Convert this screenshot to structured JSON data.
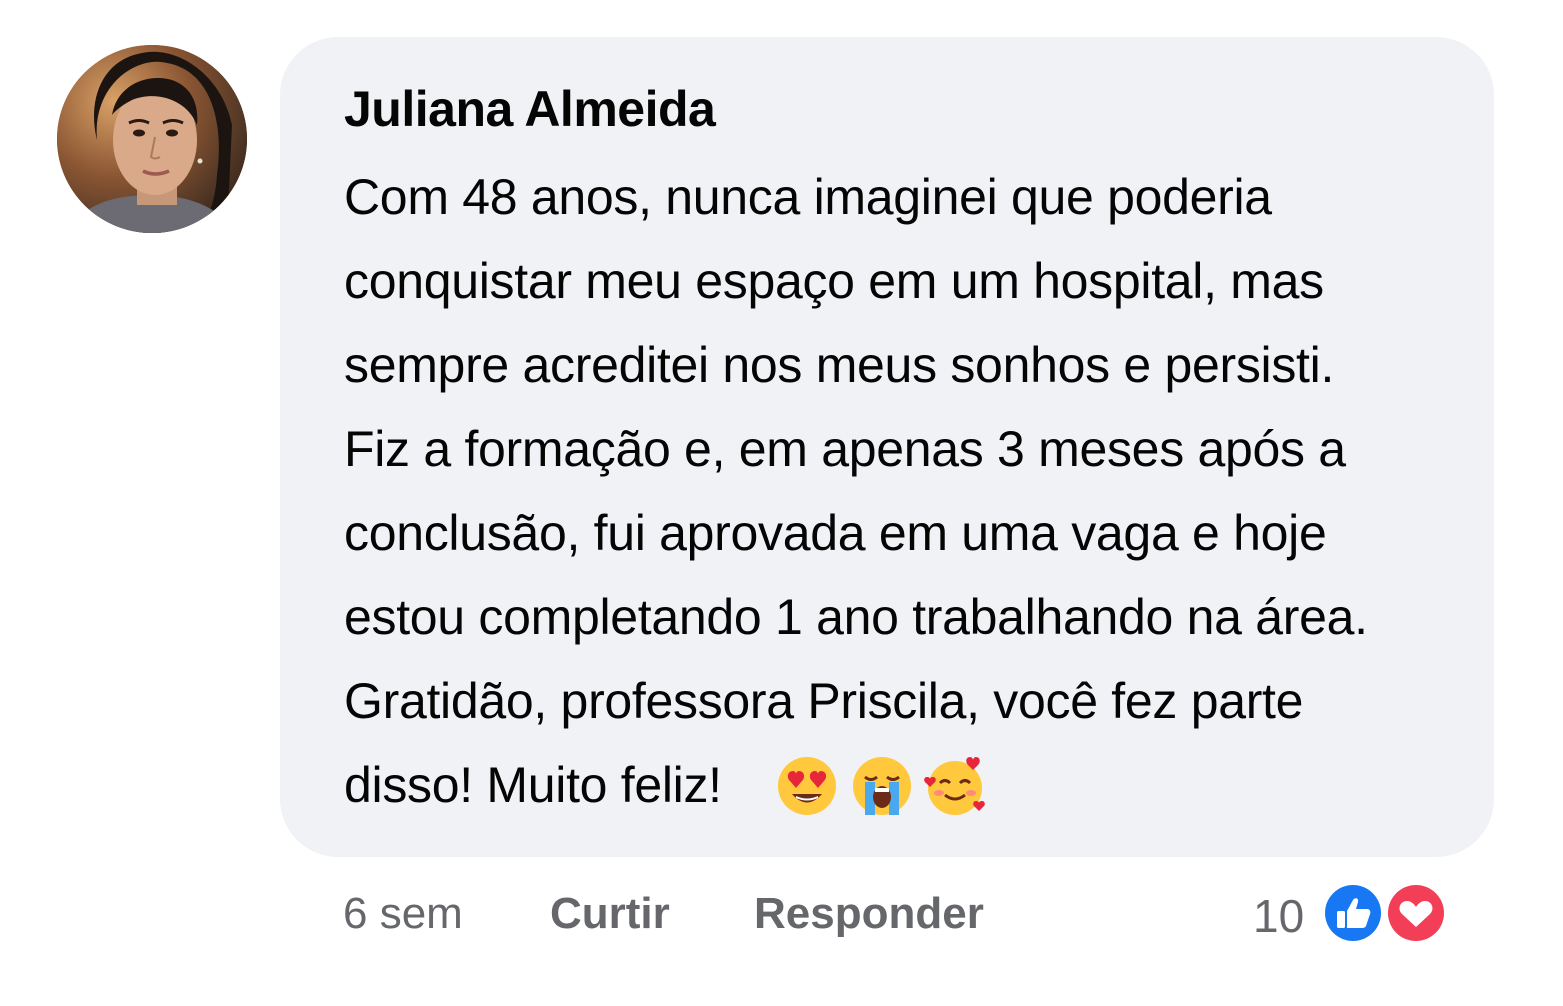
{
  "comment": {
    "author": "Juliana Almeida",
    "lines": [
      "Com 48 anos, nunca imaginei que poderia",
      "conquistar meu espaço em um hospital, mas",
      "sempre acreditei nos meus sonhos e persisti.",
      "Fiz a formação e, em apenas 3 meses após a",
      "conclusão, fui aprovada em uma vaga e hoje",
      "estou completando 1 ano trabalhando na área.",
      "Gratidão, professora Priscila, você fez parte",
      "disso! Muito feliz!"
    ],
    "emojis": [
      "heart-eyes-emoji",
      "loudly-crying-emoji",
      "smiling-face-with-hearts-emoji"
    ]
  },
  "actions": {
    "time": "6 sem",
    "like_label": "Curtir",
    "reply_label": "Responder"
  },
  "reactions": {
    "count": "10",
    "types": [
      "like-icon",
      "love-icon"
    ],
    "colors": {
      "like": "#1877f2",
      "love": "#f33e58"
    }
  },
  "colors": {
    "bubble": "#f0f2f5",
    "text": "#050505",
    "secondary": "#65676b"
  }
}
